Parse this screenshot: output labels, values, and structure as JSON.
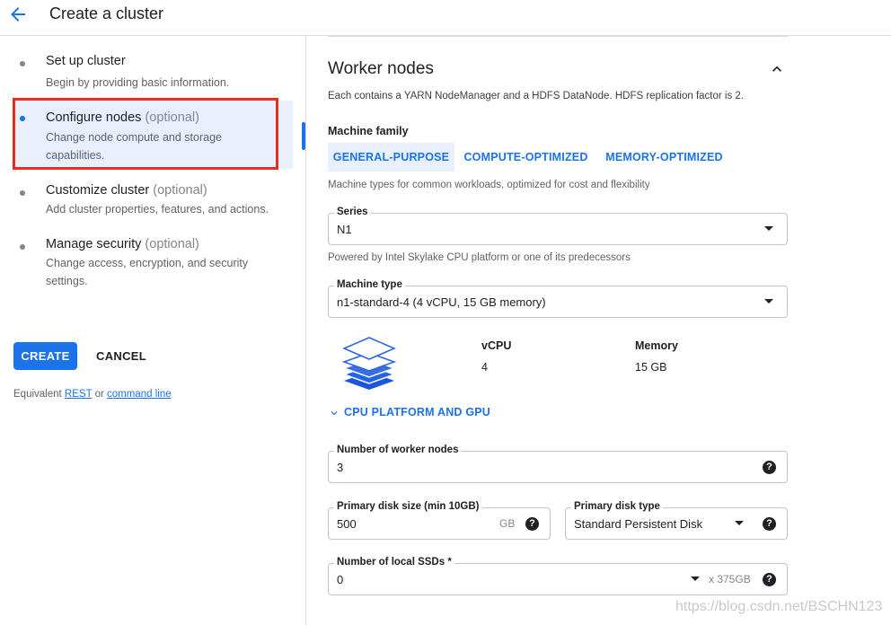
{
  "header": {
    "title": "Create a cluster",
    "back_icon": "arrow-back-icon"
  },
  "steps": [
    {
      "title": "Set up cluster",
      "optional": "",
      "description": [
        "Begin by providing basic information."
      ]
    },
    {
      "title": "Configure nodes",
      "optional": "(optional)",
      "description": [
        "Change node compute and storage",
        "capabilities."
      ],
      "active": true
    },
    {
      "title": "Customize cluster",
      "optional": "(optional)",
      "description": [
        "Add cluster properties, features, and actions."
      ]
    },
    {
      "title": "Manage security",
      "optional": "(optional)",
      "description": [
        "Change access, encryption, and security",
        "settings."
      ]
    }
  ],
  "actions": {
    "create": "CREATE",
    "cancel": "CANCEL"
  },
  "equivalent": {
    "prefix": "Equivalent",
    "rest": "REST",
    "or": "or",
    "command_line": "command line"
  },
  "section": {
    "title": "Worker nodes",
    "description": "Each contains a YARN NodeManager and a HDFS DataNode. HDFS replication factor is 2.",
    "machine_family_label": "Machine family",
    "tabs": [
      "GENERAL-PURPOSE",
      "COMPUTE-OPTIMIZED",
      "MEMORY-OPTIMIZED"
    ],
    "selected_tab": "GENERAL-PURPOSE",
    "family_hint": "Machine types for common workloads, optimized for cost and flexibility",
    "series": {
      "label": "Series",
      "value": "N1",
      "hint": "Powered by Intel Skylake CPU platform or one of its predecessors"
    },
    "machine_type": {
      "label": "Machine type",
      "value": "n1-standard-4 (4 vCPU, 15 GB memory)"
    },
    "specs": {
      "vcpu_label": "vCPU",
      "vcpu_value": "4",
      "memory_label": "Memory",
      "memory_value": "15 GB"
    },
    "expand_label": "CPU PLATFORM AND GPU",
    "worker_nodes": {
      "label": "Number of worker nodes",
      "value": "3"
    },
    "disk_size": {
      "label": "Primary disk size (min 10GB)",
      "value": "500",
      "unit": "GB"
    },
    "disk_type": {
      "label": "Primary disk type",
      "value": "Standard Persistent Disk"
    },
    "local_ssds": {
      "label": "Number of local SSDs *",
      "value": "0",
      "unit": "x 375GB"
    }
  },
  "watermark": "https://blog.csdn.net/BSCHN123",
  "colors": {
    "accent": "#1a73e8",
    "active_bg": "#e8f0fe",
    "highlight": "#ea2c1f"
  }
}
